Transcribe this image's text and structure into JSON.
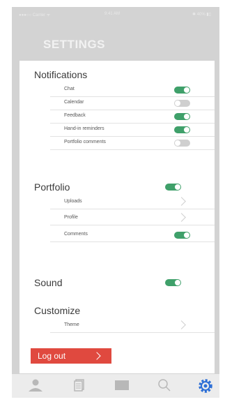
{
  "status_bar": {
    "carrier": "●●●○○ Carrier ᯤ",
    "time": "9:41 AM",
    "battery": "✱ 40% ▮▯"
  },
  "page_title": "SETTINGS",
  "notifications": {
    "title": "Notifications",
    "items": [
      {
        "label": "Chat",
        "on": true
      },
      {
        "label": "Calendar",
        "on": false
      },
      {
        "label": "Feedback",
        "on": true
      },
      {
        "label": "Hand-in reminders",
        "on": true
      },
      {
        "label": "Portfolio comments",
        "on": false
      }
    ]
  },
  "portfolio": {
    "title": "Portfolio",
    "on": true,
    "items": [
      {
        "label": "Uploads",
        "kind": "link"
      },
      {
        "label": "Profile",
        "kind": "link"
      },
      {
        "label": "Comments",
        "kind": "toggle",
        "on": true
      }
    ]
  },
  "sound": {
    "title": "Sound",
    "on": true
  },
  "customize": {
    "title": "Customize",
    "items": [
      {
        "label": "Theme",
        "kind": "link"
      }
    ]
  },
  "logout_label": "Log out",
  "tabs": [
    {
      "icon": "person-icon",
      "active": false
    },
    {
      "icon": "documents-icon",
      "active": false
    },
    {
      "icon": "chat-icon",
      "active": false
    },
    {
      "icon": "search-icon",
      "active": false
    },
    {
      "icon": "gear-icon",
      "active": true
    }
  ],
  "colors": {
    "accent": "#3fa06a",
    "danger": "#e0493f",
    "active_tab": "#2d6fd6",
    "inactive_icon": "#b8b8b8"
  }
}
